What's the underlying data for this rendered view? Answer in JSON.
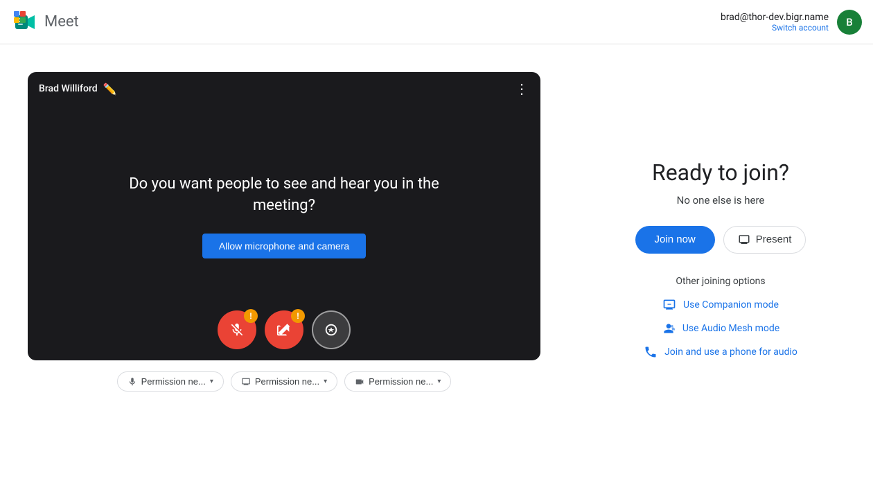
{
  "header": {
    "app_name": "Meet",
    "user_email": "brad@thor-dev.bigr.name",
    "switch_account_label": "Switch account",
    "avatar_initial": "B",
    "avatar_color": "#188038"
  },
  "video_panel": {
    "user_name": "Brad Williford",
    "message": "Do you want people to see and hear you in the meeting?",
    "allow_btn_label": "Allow microphone and camera",
    "permissions": [
      {
        "icon": "mic-icon",
        "label": "Permission ne..."
      },
      {
        "icon": "screen-icon",
        "label": "Permission ne..."
      },
      {
        "icon": "camera-icon",
        "label": "Permission ne..."
      }
    ]
  },
  "right_panel": {
    "ready_title": "Ready to join?",
    "no_one_text": "No one else is here",
    "join_now_label": "Join now",
    "present_label": "Present",
    "other_options_title": "Other joining options",
    "options": [
      {
        "id": "companion",
        "label": "Use Companion mode"
      },
      {
        "id": "audio-mesh",
        "label": "Use Audio Mesh mode"
      },
      {
        "id": "phone-audio",
        "label": "Join and use a phone for audio"
      }
    ]
  }
}
